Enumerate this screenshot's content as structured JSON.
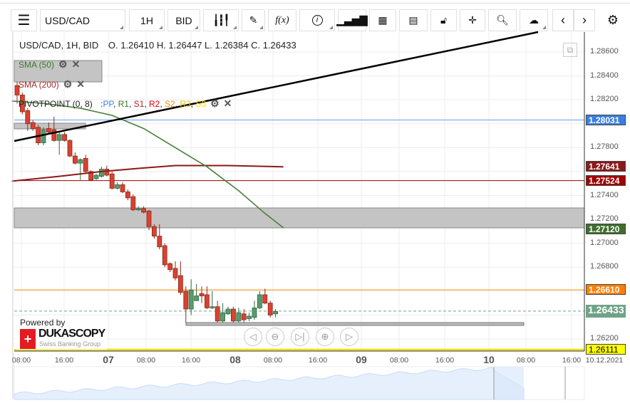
{
  "toolbar": {
    "symbol": "USD/CAD",
    "timeframe": "1H",
    "side": "BID",
    "buttons": [
      "menu-icon",
      "candles-icon",
      "draw-icon",
      "fx-icon",
      "info-icon",
      "volume-icon",
      "calendar-icon",
      "report-icon",
      "lock-icon",
      "crosshair-icon",
      "zoom-icon",
      "upload-icon",
      "prev-icon",
      "next-icon",
      "settings-icon"
    ],
    "fx_label": "f(x)"
  },
  "header": {
    "instrument": "USD/CAD, 1H, BID",
    "ohlc": "O. 1.26410 H. 1.26447 L. 1.26384 C. 1.26433"
  },
  "indicators": {
    "sma50": "SMA (50)",
    "sma200": "SMA (200)",
    "pivot": "PIVOTPOINT (0, 8)",
    "pivot_sep": ":",
    "pivot_parts": [
      {
        "t": "PP",
        "c": "#3b82f6"
      },
      {
        "t": "R1",
        "c": "#3a7a2a"
      },
      {
        "t": "S1",
        "c": "#b22222"
      },
      {
        "t": "R2",
        "c": "#e00000"
      },
      {
        "t": "S2",
        "c": "#ff8c00"
      },
      {
        "t": "R3",
        "c": "#f0c000"
      },
      {
        "t": "S3",
        "c": "#f5e000"
      }
    ]
  },
  "price_axis": [
    "1.28600",
    "1.28400",
    "1.28200",
    "1.27800",
    "1.27400",
    "1.27200",
    "1.27000",
    "1.26800",
    "1.26200"
  ],
  "price_tags": [
    {
      "value": "1.28031",
      "color": "#3b7fe0"
    },
    {
      "value": "1.27641",
      "color": "#8b1a1a"
    },
    {
      "value": "1.27524",
      "color": "#a00000"
    },
    {
      "value": "1.27120",
      "color": "#3f6e2f"
    },
    {
      "value": "1.26610",
      "color": "#ff7f00"
    },
    {
      "value": "1.26433",
      "color": "#6fa387"
    },
    {
      "value": "1.26111",
      "color": "#ffff00"
    }
  ],
  "time_axis": [
    {
      "t": "08:00",
      "big": false
    },
    {
      "t": "16:00",
      "big": false
    },
    {
      "t": "07",
      "big": true
    },
    {
      "t": "08:00",
      "big": false
    },
    {
      "t": "16:00",
      "big": false
    },
    {
      "t": "08",
      "big": true
    },
    {
      "t": "08:00",
      "big": false
    },
    {
      "t": "16:00",
      "big": false
    },
    {
      "t": "09",
      "big": true
    },
    {
      "t": "08:00",
      "big": false
    },
    {
      "t": "16:00",
      "big": false
    },
    {
      "t": "10",
      "big": true
    },
    {
      "t": "08:00",
      "big": false
    },
    {
      "t": "16:00",
      "big": false
    },
    {
      "t": "10.12.2021",
      "big": false
    }
  ],
  "branding": {
    "powered": "Powered by",
    "name": "DUKASCOPY",
    "sub": "Swiss Banking Group"
  },
  "chart_data": {
    "type": "candlestick",
    "ylim": [
      1.2605,
      1.287
    ],
    "candles_ohlc": [
      [
        1.2832,
        1.2835,
        1.2817,
        1.2824
      ],
      [
        1.2824,
        1.2826,
        1.2808,
        1.281
      ],
      [
        1.2811,
        1.2813,
        1.2794,
        1.28
      ],
      [
        1.2801,
        1.2803,
        1.2794,
        1.2796
      ],
      [
        1.2797,
        1.2799,
        1.2782,
        1.2784
      ],
      [
        1.2784,
        1.2797,
        1.2782,
        1.2795
      ],
      [
        1.2796,
        1.2801,
        1.2791,
        1.2793
      ],
      [
        1.2795,
        1.2806,
        1.2785,
        1.2786
      ],
      [
        1.2786,
        1.2793,
        1.2774,
        1.2791
      ],
      [
        1.2791,
        1.2793,
        1.2785,
        1.2786
      ],
      [
        1.2786,
        1.2787,
        1.2772,
        1.2773
      ],
      [
        1.2773,
        1.2776,
        1.2766,
        1.2767
      ],
      [
        1.2767,
        1.2771,
        1.2753,
        1.277
      ],
      [
        1.2771,
        1.2774,
        1.2759,
        1.276
      ],
      [
        1.276,
        1.2761,
        1.2752,
        1.2753
      ],
      [
        1.2754,
        1.2758,
        1.2753,
        1.2757
      ],
      [
        1.2756,
        1.2764,
        1.2755,
        1.2762
      ],
      [
        1.2762,
        1.2765,
        1.2756,
        1.2757
      ],
      [
        1.2758,
        1.276,
        1.2745,
        1.2746
      ],
      [
        1.2746,
        1.2751,
        1.2745,
        1.2749
      ],
      [
        1.2749,
        1.2751,
        1.2742,
        1.2743
      ],
      [
        1.2743,
        1.2745,
        1.2736,
        1.2738
      ],
      [
        1.2739,
        1.2741,
        1.2727,
        1.2728
      ],
      [
        1.2728,
        1.2731,
        1.2727,
        1.2729
      ],
      [
        1.2729,
        1.2731,
        1.2725,
        1.2726
      ],
      [
        1.2727,
        1.2728,
        1.2711,
        1.2714
      ],
      [
        1.2714,
        1.2716,
        1.2704,
        1.2706
      ],
      [
        1.2706,
        1.2716,
        1.2695,
        1.2697
      ],
      [
        1.2698,
        1.27,
        1.268,
        1.2682
      ],
      [
        1.2683,
        1.2684,
        1.2676,
        1.2678
      ],
      [
        1.2679,
        1.2685,
        1.2669,
        1.2671
      ],
      [
        1.2673,
        1.2685,
        1.2657,
        1.2659
      ],
      [
        1.266,
        1.2664,
        1.2633,
        1.2645
      ],
      [
        1.2645,
        1.267,
        1.264,
        1.2661
      ],
      [
        1.2652,
        1.2666,
        1.2652,
        1.2656
      ],
      [
        1.2658,
        1.2664,
        1.265,
        1.2656
      ],
      [
        1.2657,
        1.2664,
        1.2645,
        1.2646
      ],
      [
        1.2646,
        1.266,
        1.2645,
        1.2647
      ],
      [
        1.2647,
        1.2652,
        1.2633,
        1.2635
      ],
      [
        1.2635,
        1.265,
        1.2634,
        1.2642
      ],
      [
        1.2641,
        1.2647,
        1.264,
        1.2645
      ],
      [
        1.2645,
        1.2647,
        1.2634,
        1.2635
      ],
      [
        1.2635,
        1.2646,
        1.2633,
        1.2642
      ],
      [
        1.2641,
        1.2645,
        1.2634,
        1.2636
      ],
      [
        1.2637,
        1.2642,
        1.2635,
        1.2639
      ],
      [
        1.2638,
        1.2652,
        1.2636,
        1.2646
      ],
      [
        1.2646,
        1.266,
        1.2645,
        1.2657
      ],
      [
        1.2657,
        1.2662,
        1.2649,
        1.265
      ],
      [
        1.265,
        1.2652,
        1.2638,
        1.264
      ],
      [
        1.2641,
        1.2645,
        1.2638,
        1.2643
      ]
    ],
    "sma50": [
      [
        -1,
        1.2819
      ],
      [
        5,
        1.2817
      ],
      [
        12,
        1.2813
      ],
      [
        18,
        1.2807
      ],
      [
        24,
        1.2796
      ],
      [
        30,
        1.278
      ],
      [
        36,
        1.2764
      ],
      [
        42,
        1.2744
      ],
      [
        47,
        1.2725
      ],
      [
        50.5,
        1.2713
      ]
    ],
    "sma200": [
      [
        -1,
        1.2752
      ],
      [
        8,
        1.2756
      ],
      [
        16,
        1.276
      ],
      [
        24,
        1.2763
      ],
      [
        30,
        1.2765
      ],
      [
        40,
        1.2765
      ],
      [
        50.5,
        1.2764
      ]
    ],
    "levels": {
      "pp": 1.28031,
      "r1": 1.2712,
      "s1": 1.27524,
      "s2": 1.2661,
      "s3": 1.26111,
      "last": 1.26433
    }
  }
}
